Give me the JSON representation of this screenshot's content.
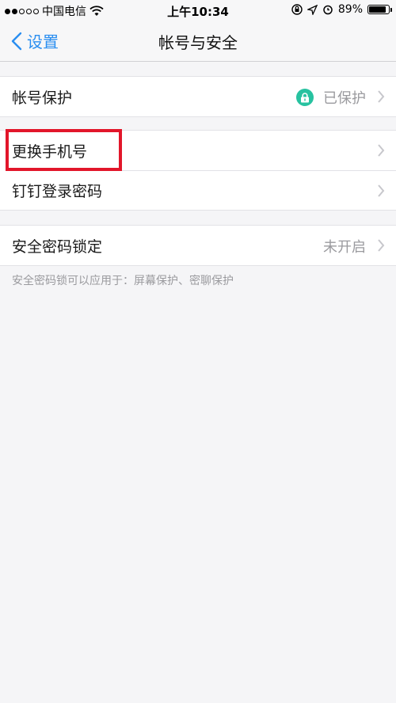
{
  "status_bar": {
    "carrier": "中国电信",
    "time": "上午10:34",
    "battery": "89%",
    "battery_level": 0.89,
    "signal_dots_filled": 2,
    "signal_dots_total": 5
  },
  "nav": {
    "back_label": "设置",
    "title": "帐号与安全"
  },
  "groups": [
    {
      "rows": [
        {
          "label": "帐号保护",
          "value": "已保护",
          "icon": "lock-icon"
        }
      ]
    },
    {
      "rows": [
        {
          "label": "更换手机号",
          "value": ""
        },
        {
          "label": "钉钉登录密码",
          "value": ""
        }
      ]
    },
    {
      "rows": [
        {
          "label": "安全密码锁定",
          "value": "未开启"
        }
      ]
    }
  ],
  "hint": "安全密码锁可以应用于：屏幕保护、密聊保护",
  "colors": {
    "accent": "#2a8ef0",
    "lock_badge": "#27c2a0",
    "highlight": "#e2162a"
  }
}
